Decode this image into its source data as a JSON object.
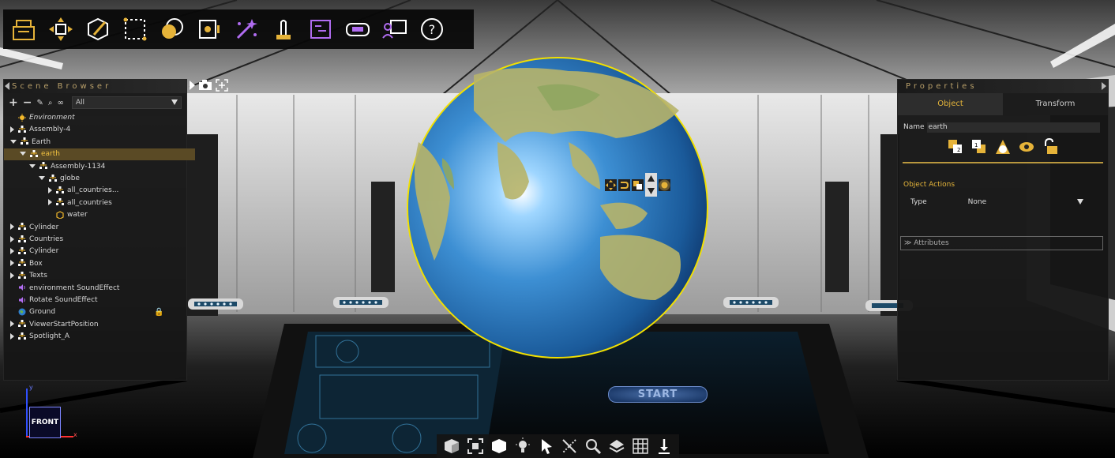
{
  "colors": {
    "accent": "#e4b43a",
    "panel_bg": "#161616",
    "selection": "#5a4a25",
    "globe_outline": "#f2e000"
  },
  "toolbar": {
    "items": [
      {
        "icon": "open-scene-icon"
      },
      {
        "icon": "move-tool-icon"
      },
      {
        "icon": "edit-object-icon"
      },
      {
        "icon": "select-region-icon"
      },
      {
        "icon": "materials-icon"
      },
      {
        "icon": "media-icon"
      },
      {
        "icon": "effects-wand-icon"
      },
      {
        "icon": "interaction-icon"
      },
      {
        "icon": "timeline-icon"
      },
      {
        "icon": "vr-headset-icon"
      },
      {
        "icon": "presenter-icon"
      },
      {
        "icon": "help-icon"
      }
    ]
  },
  "scene_browser": {
    "title": "Scene Browser",
    "filter": "All",
    "items": [
      {
        "label": "Environment",
        "indent": 0,
        "twisty": "none",
        "icon": "sun-icon",
        "italic": true
      },
      {
        "label": "Assembly-4",
        "indent": 0,
        "twisty": "closed",
        "icon": "assembly-icon"
      },
      {
        "label": "Earth",
        "indent": 0,
        "twisty": "open",
        "icon": "assembly-icon"
      },
      {
        "label": "earth",
        "indent": 1,
        "twisty": "open",
        "icon": "assembly-icon",
        "selected": true
      },
      {
        "label": "Assembly-1134",
        "indent": 2,
        "twisty": "open",
        "icon": "assembly-icon"
      },
      {
        "label": "globe",
        "indent": 3,
        "twisty": "open",
        "icon": "assembly-icon"
      },
      {
        "label": "all_countries...",
        "indent": 4,
        "twisty": "closed",
        "icon": "assembly-icon"
      },
      {
        "label": "all_countries",
        "indent": 4,
        "twisty": "closed",
        "icon": "assembly-icon"
      },
      {
        "label": "water",
        "indent": 4,
        "twisty": "none",
        "icon": "mesh-icon"
      },
      {
        "label": "Cylinder",
        "indent": 0,
        "twisty": "closed",
        "icon": "assembly-icon"
      },
      {
        "label": "Countries",
        "indent": 0,
        "twisty": "closed",
        "icon": "assembly-icon"
      },
      {
        "label": "Cylinder",
        "indent": 0,
        "twisty": "closed",
        "icon": "assembly-icon"
      },
      {
        "label": "Box",
        "indent": 0,
        "twisty": "closed",
        "icon": "assembly-icon"
      },
      {
        "label": "Texts",
        "indent": 0,
        "twisty": "closed",
        "icon": "assembly-icon"
      },
      {
        "label": "environment SoundEffect",
        "indent": 0,
        "twisty": "none",
        "icon": "sound-icon"
      },
      {
        "label": "Rotate SoundEffect",
        "indent": 0,
        "twisty": "none",
        "icon": "sound-icon"
      },
      {
        "label": "Ground",
        "indent": 0,
        "twisty": "none",
        "icon": "ground-icon",
        "locked": true
      },
      {
        "label": "ViewerStartPosition",
        "indent": 0,
        "twisty": "closed",
        "icon": "assembly-icon"
      },
      {
        "label": "Spotlight_A",
        "indent": 0,
        "twisty": "closed",
        "icon": "assembly-icon"
      }
    ]
  },
  "properties": {
    "title": "Properties",
    "tabs": [
      {
        "label": "Object",
        "active": true
      },
      {
        "label": "Transform",
        "active": false
      }
    ],
    "name_label": "Name",
    "name_value": "earth",
    "icons": [
      "layer-1-icon",
      "layer-2-icon",
      "shape-icon",
      "visibility-eye-icon",
      "unlock-icon"
    ],
    "section_title": "Object Actions",
    "type_label": "Type",
    "type_value": "None",
    "attributes_label": "Attributes"
  },
  "viewport": {
    "start_label": "START",
    "orientation_label": "FRONT",
    "axis_y": "y",
    "axis_x": "x"
  },
  "bottom_toolbar": {
    "items": [
      "view-cube-icon",
      "frame-icon",
      "shading-icon",
      "light-bulb-icon",
      "pointer-icon",
      "collision-icon",
      "zoom-search-icon",
      "layers-icon",
      "grid-icon",
      "drop-to-ground-icon"
    ]
  }
}
